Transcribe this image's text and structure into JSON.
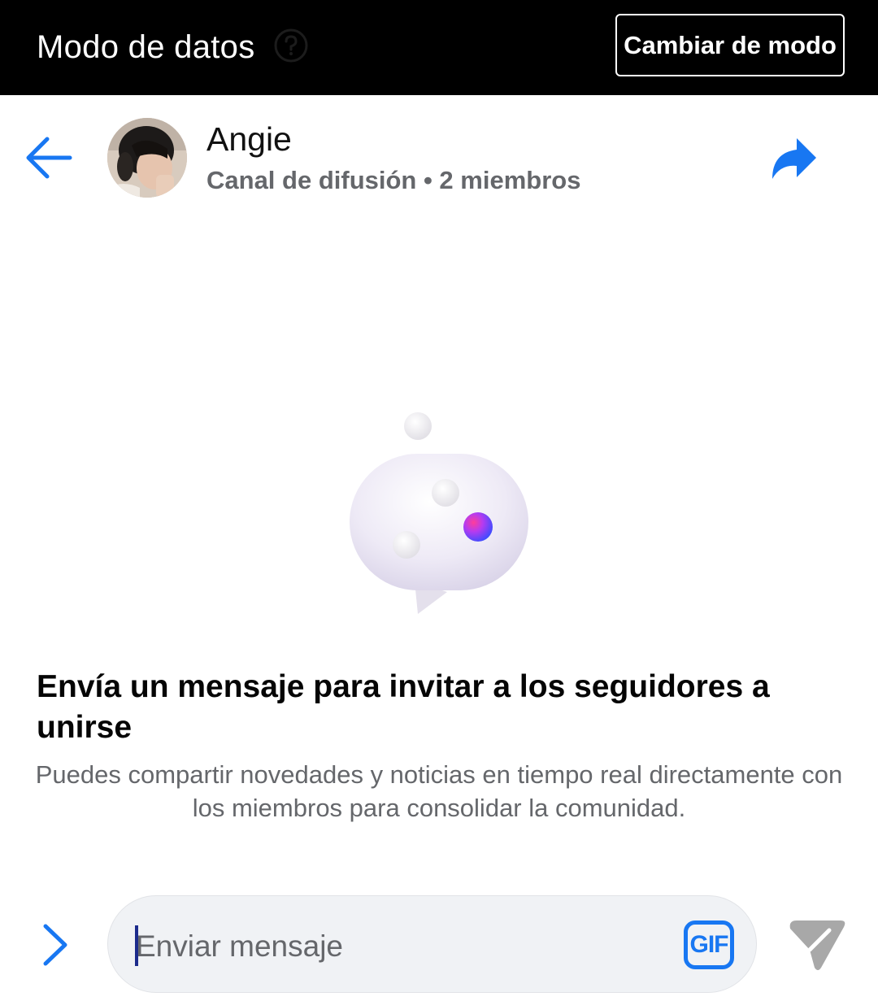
{
  "mode_bar": {
    "title": "Modo de datos",
    "help_icon": "question-circle-icon",
    "switch_label": "Cambiar de modo"
  },
  "header": {
    "back_icon": "arrow-left-icon",
    "name": "Angie",
    "subtitle": "Canal de difusión • 2 miembros",
    "share_icon": "share-arrow-icon"
  },
  "empty_state": {
    "illustration": "chat-bubble-illustration",
    "title": "Envía un mensaje para invitar a los seguidores a unirse",
    "description": "Puedes compartir novedades y noticias en tiempo real directamente con los miembros para consolidar la comunidad."
  },
  "composer": {
    "expand_icon": "chevron-right-icon",
    "placeholder": "Enviar mensaje",
    "value": "",
    "gif_label": "GIF",
    "send_icon": "send-icon"
  },
  "colors": {
    "accent": "#1877f2",
    "bar": "#000000",
    "secondary_text": "#65676b",
    "composer_bg": "#f0f2f5",
    "send_disabled": "#a8a8a8"
  }
}
